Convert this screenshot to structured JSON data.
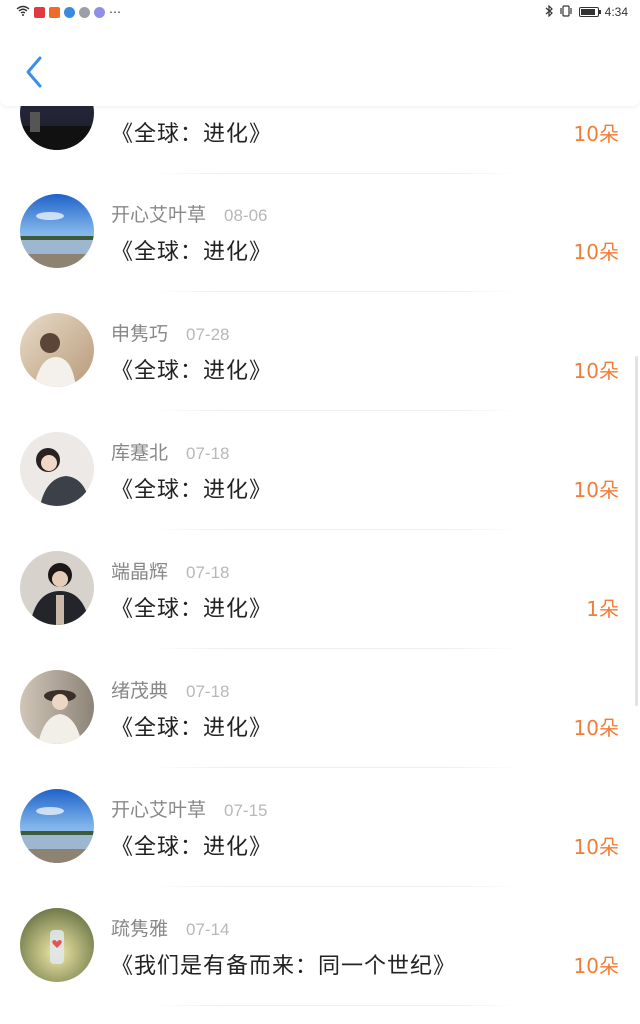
{
  "status_bar": {
    "time": "4:34",
    "more": "⋯",
    "left_icons": [
      "wifi-icon",
      "app-red-icon",
      "app-orange-icon",
      "app-blue-icon",
      "wechat-icon",
      "app-lavender-icon"
    ],
    "right_icons": [
      "bluetooth-icon",
      "vibrate-icon",
      "battery-icon"
    ]
  },
  "nav": {
    "back_icon": "chevron-left-icon",
    "accent": "#3b8ee8"
  },
  "colors": {
    "amount": "#f07d3a",
    "username": "#888888",
    "date": "#b8b8b8",
    "title": "#222222"
  },
  "rows": [
    {
      "username": "",
      "date": "",
      "title": "《全球：进化》",
      "amount": "10朵",
      "avatar": "night-sky-avatar"
    },
    {
      "username": "开心艾叶草",
      "date": "08-06",
      "title": "《全球：进化》",
      "amount": "10朵",
      "avatar": "lake-sky-avatar"
    },
    {
      "username": "申隽巧",
      "date": "07-28",
      "title": "《全球：进化》",
      "amount": "10朵",
      "avatar": "girl-sunlight-avatar"
    },
    {
      "username": "库蹇北",
      "date": "07-18",
      "title": "《全球：进化》",
      "amount": "10朵",
      "avatar": "girl-portrait-avatar"
    },
    {
      "username": "端晶辉",
      "date": "07-18",
      "title": "《全球：进化》",
      "amount": "1朵",
      "avatar": "boy-jacket-avatar"
    },
    {
      "username": "绪茂典",
      "date": "07-18",
      "title": "《全球：进化》",
      "amount": "10朵",
      "avatar": "girl-hat-avatar"
    },
    {
      "username": "开心艾叶草",
      "date": "07-15",
      "title": "《全球：进化》",
      "amount": "10朵",
      "avatar": "lake-sky-avatar"
    },
    {
      "username": "疏隽雅",
      "date": "07-14",
      "title": "《我们是有备而来：同一个世纪》",
      "amount": "10朵",
      "avatar": "jar-heart-avatar"
    }
  ]
}
